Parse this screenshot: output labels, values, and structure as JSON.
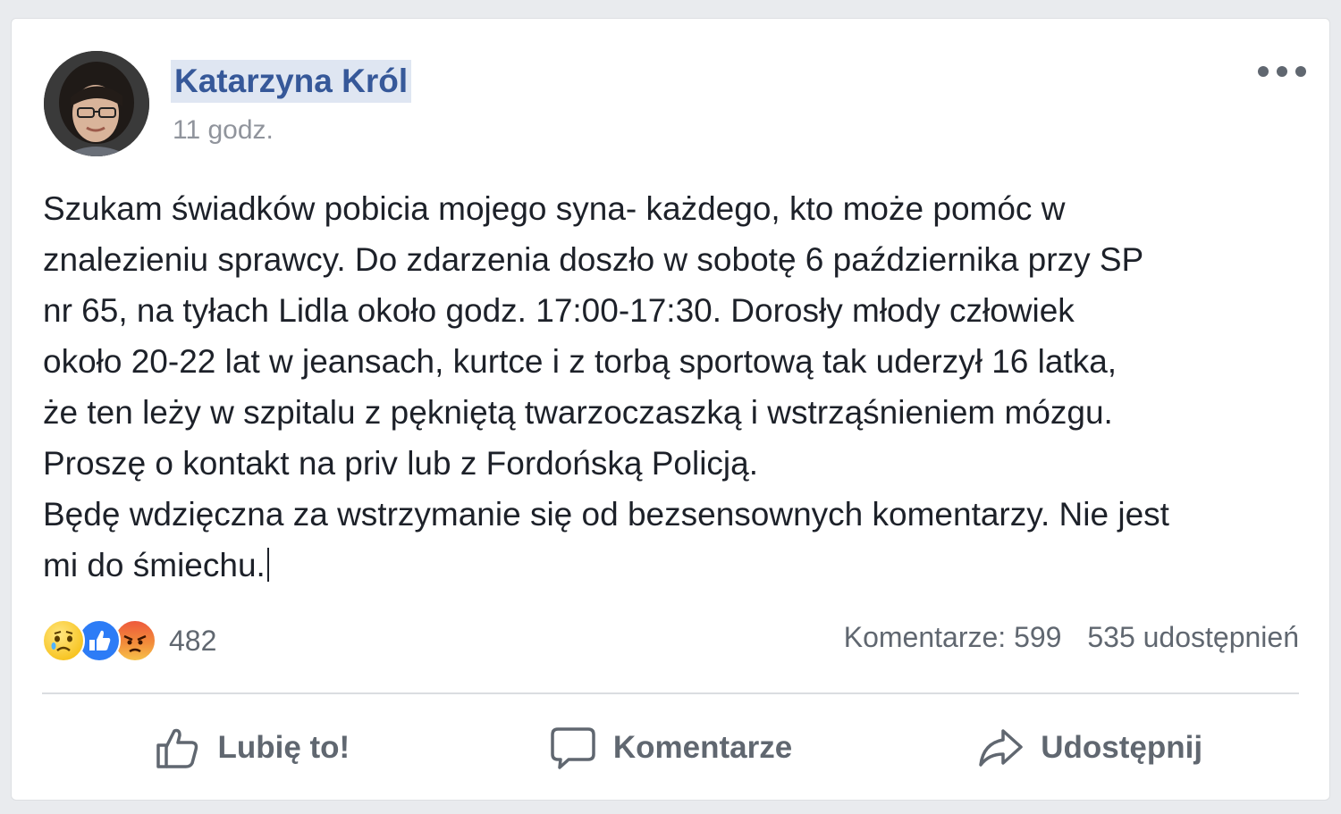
{
  "post": {
    "author": "Katarzyna Król",
    "time": "11 godz.",
    "text_lines": [
      "Szukam świadków pobicia mojego syna- każdego, kto może pomóc w",
      "znalezieniu sprawcy. Do zdarzenia doszło w sobotę 6 października przy SP",
      "nr 65, na tyłach Lidla około godz. 17:00-17:30. Dorosły młody człowiek",
      "około 20-22 lat w jeansach, kurtce i z torbą sportową tak uderzył 16 latka,",
      "że ten leży w szpitalu z pękniętą twarzoczaszką i wstrząśnieniem mózgu.",
      "Proszę o kontakt na priv lub z Fordońską Policją.",
      "Będę wdzięczna za wstrzymanie się od bezsensownych komentarzy. Nie jest",
      "mi do śmiechu."
    ]
  },
  "reactions": {
    "icons": [
      "sad-reaction-icon",
      "like-reaction-icon",
      "angry-reaction-icon"
    ],
    "count": "482"
  },
  "stats": {
    "comments": "Komentarze: 599",
    "shares": "535 udostępnień"
  },
  "actions": {
    "like": "Lubię to!",
    "comment": "Komentarze",
    "share": "Udostępnij"
  },
  "colors": {
    "author_link": "#365899",
    "like_blue": "#2d7cf6",
    "meta_gray": "#606770"
  }
}
